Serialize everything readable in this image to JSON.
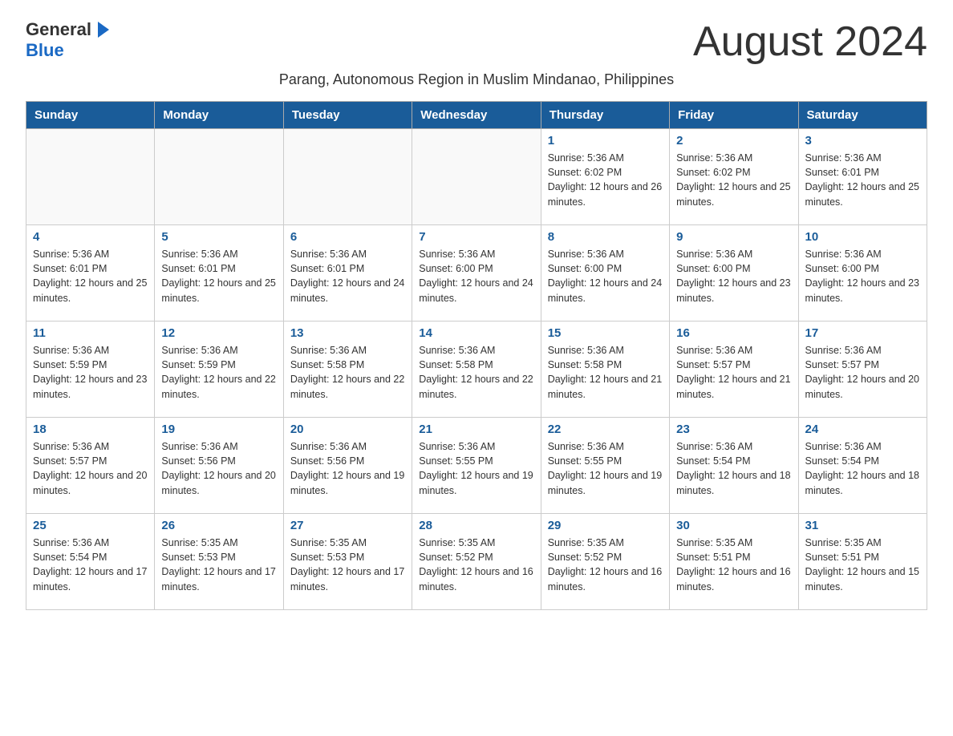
{
  "header": {
    "logo_general": "General",
    "logo_blue": "Blue",
    "month_title": "August 2024",
    "subtitle": "Parang, Autonomous Region in Muslim Mindanao, Philippines"
  },
  "days_of_week": [
    "Sunday",
    "Monday",
    "Tuesday",
    "Wednesday",
    "Thursday",
    "Friday",
    "Saturday"
  ],
  "weeks": [
    [
      {
        "day": "",
        "info": ""
      },
      {
        "day": "",
        "info": ""
      },
      {
        "day": "",
        "info": ""
      },
      {
        "day": "",
        "info": ""
      },
      {
        "day": "1",
        "info": "Sunrise: 5:36 AM\nSunset: 6:02 PM\nDaylight: 12 hours and 26 minutes."
      },
      {
        "day": "2",
        "info": "Sunrise: 5:36 AM\nSunset: 6:02 PM\nDaylight: 12 hours and 25 minutes."
      },
      {
        "day": "3",
        "info": "Sunrise: 5:36 AM\nSunset: 6:01 PM\nDaylight: 12 hours and 25 minutes."
      }
    ],
    [
      {
        "day": "4",
        "info": "Sunrise: 5:36 AM\nSunset: 6:01 PM\nDaylight: 12 hours and 25 minutes."
      },
      {
        "day": "5",
        "info": "Sunrise: 5:36 AM\nSunset: 6:01 PM\nDaylight: 12 hours and 25 minutes."
      },
      {
        "day": "6",
        "info": "Sunrise: 5:36 AM\nSunset: 6:01 PM\nDaylight: 12 hours and 24 minutes."
      },
      {
        "day": "7",
        "info": "Sunrise: 5:36 AM\nSunset: 6:00 PM\nDaylight: 12 hours and 24 minutes."
      },
      {
        "day": "8",
        "info": "Sunrise: 5:36 AM\nSunset: 6:00 PM\nDaylight: 12 hours and 24 minutes."
      },
      {
        "day": "9",
        "info": "Sunrise: 5:36 AM\nSunset: 6:00 PM\nDaylight: 12 hours and 23 minutes."
      },
      {
        "day": "10",
        "info": "Sunrise: 5:36 AM\nSunset: 6:00 PM\nDaylight: 12 hours and 23 minutes."
      }
    ],
    [
      {
        "day": "11",
        "info": "Sunrise: 5:36 AM\nSunset: 5:59 PM\nDaylight: 12 hours and 23 minutes."
      },
      {
        "day": "12",
        "info": "Sunrise: 5:36 AM\nSunset: 5:59 PM\nDaylight: 12 hours and 22 minutes."
      },
      {
        "day": "13",
        "info": "Sunrise: 5:36 AM\nSunset: 5:58 PM\nDaylight: 12 hours and 22 minutes."
      },
      {
        "day": "14",
        "info": "Sunrise: 5:36 AM\nSunset: 5:58 PM\nDaylight: 12 hours and 22 minutes."
      },
      {
        "day": "15",
        "info": "Sunrise: 5:36 AM\nSunset: 5:58 PM\nDaylight: 12 hours and 21 minutes."
      },
      {
        "day": "16",
        "info": "Sunrise: 5:36 AM\nSunset: 5:57 PM\nDaylight: 12 hours and 21 minutes."
      },
      {
        "day": "17",
        "info": "Sunrise: 5:36 AM\nSunset: 5:57 PM\nDaylight: 12 hours and 20 minutes."
      }
    ],
    [
      {
        "day": "18",
        "info": "Sunrise: 5:36 AM\nSunset: 5:57 PM\nDaylight: 12 hours and 20 minutes."
      },
      {
        "day": "19",
        "info": "Sunrise: 5:36 AM\nSunset: 5:56 PM\nDaylight: 12 hours and 20 minutes."
      },
      {
        "day": "20",
        "info": "Sunrise: 5:36 AM\nSunset: 5:56 PM\nDaylight: 12 hours and 19 minutes."
      },
      {
        "day": "21",
        "info": "Sunrise: 5:36 AM\nSunset: 5:55 PM\nDaylight: 12 hours and 19 minutes."
      },
      {
        "day": "22",
        "info": "Sunrise: 5:36 AM\nSunset: 5:55 PM\nDaylight: 12 hours and 19 minutes."
      },
      {
        "day": "23",
        "info": "Sunrise: 5:36 AM\nSunset: 5:54 PM\nDaylight: 12 hours and 18 minutes."
      },
      {
        "day": "24",
        "info": "Sunrise: 5:36 AM\nSunset: 5:54 PM\nDaylight: 12 hours and 18 minutes."
      }
    ],
    [
      {
        "day": "25",
        "info": "Sunrise: 5:36 AM\nSunset: 5:54 PM\nDaylight: 12 hours and 17 minutes."
      },
      {
        "day": "26",
        "info": "Sunrise: 5:35 AM\nSunset: 5:53 PM\nDaylight: 12 hours and 17 minutes."
      },
      {
        "day": "27",
        "info": "Sunrise: 5:35 AM\nSunset: 5:53 PM\nDaylight: 12 hours and 17 minutes."
      },
      {
        "day": "28",
        "info": "Sunrise: 5:35 AM\nSunset: 5:52 PM\nDaylight: 12 hours and 16 minutes."
      },
      {
        "day": "29",
        "info": "Sunrise: 5:35 AM\nSunset: 5:52 PM\nDaylight: 12 hours and 16 minutes."
      },
      {
        "day": "30",
        "info": "Sunrise: 5:35 AM\nSunset: 5:51 PM\nDaylight: 12 hours and 16 minutes."
      },
      {
        "day": "31",
        "info": "Sunrise: 5:35 AM\nSunset: 5:51 PM\nDaylight: 12 hours and 15 minutes."
      }
    ]
  ]
}
